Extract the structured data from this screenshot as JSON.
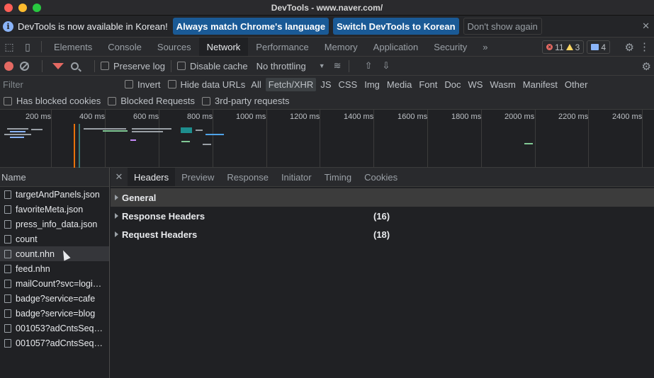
{
  "window": {
    "title": "DevTools - www.naver.com/"
  },
  "infobar": {
    "message": "DevTools is now available in Korean!",
    "btn_match": "Always match Chrome's language",
    "btn_switch": "Switch DevTools to Korean",
    "btn_dismiss": "Don't show again",
    "close": "✕"
  },
  "main_tabs": [
    "Elements",
    "Console",
    "Sources",
    "Network",
    "Performance",
    "Memory",
    "Application",
    "Security"
  ],
  "main_tabs_more": "»",
  "counts": {
    "errors": "11",
    "warnings": "3",
    "messages": "4"
  },
  "net_toolbar": {
    "preserve_log": "Preserve log",
    "disable_cache": "Disable cache",
    "throttling": "No throttling"
  },
  "filter": {
    "placeholder": "Filter",
    "invert": "Invert",
    "hide_data_urls": "Hide data URLs",
    "types": [
      "All",
      "Fetch/XHR",
      "JS",
      "CSS",
      "Img",
      "Media",
      "Font",
      "Doc",
      "WS",
      "Wasm",
      "Manifest",
      "Other"
    ],
    "active_type": "Fetch/XHR"
  },
  "cookie_filters": {
    "blocked_cookies": "Has blocked cookies",
    "blocked_requests": "Blocked Requests",
    "third_party": "3rd-party requests"
  },
  "overview_ticks": [
    "200 ms",
    "400 ms",
    "600 ms",
    "800 ms",
    "1000 ms",
    "1200 ms",
    "1400 ms",
    "1600 ms",
    "1800 ms",
    "2000 ms",
    "2200 ms",
    "2400 ms"
  ],
  "requests": {
    "header": "Name",
    "items": [
      "targetAndPanels.json",
      "favoriteMeta.json",
      "press_info_data.json",
      "count",
      "count.nhn",
      "feed.nhn",
      "mailCount?svc=login…",
      "badge?service=cafe",
      "badge?service=blog",
      "001053?adCntsSeqs…",
      "001057?adCntsSeqs…"
    ],
    "hovered": "count.nhn"
  },
  "detail": {
    "close": "✕",
    "tabs": [
      "Headers",
      "Preview",
      "Response",
      "Initiator",
      "Timing",
      "Cookies"
    ],
    "active_tab": "Headers",
    "sections": [
      {
        "label": "General",
        "count": ""
      },
      {
        "label": "Response Headers",
        "count": "(16)"
      },
      {
        "label": "Request Headers",
        "count": "(18)"
      }
    ]
  }
}
